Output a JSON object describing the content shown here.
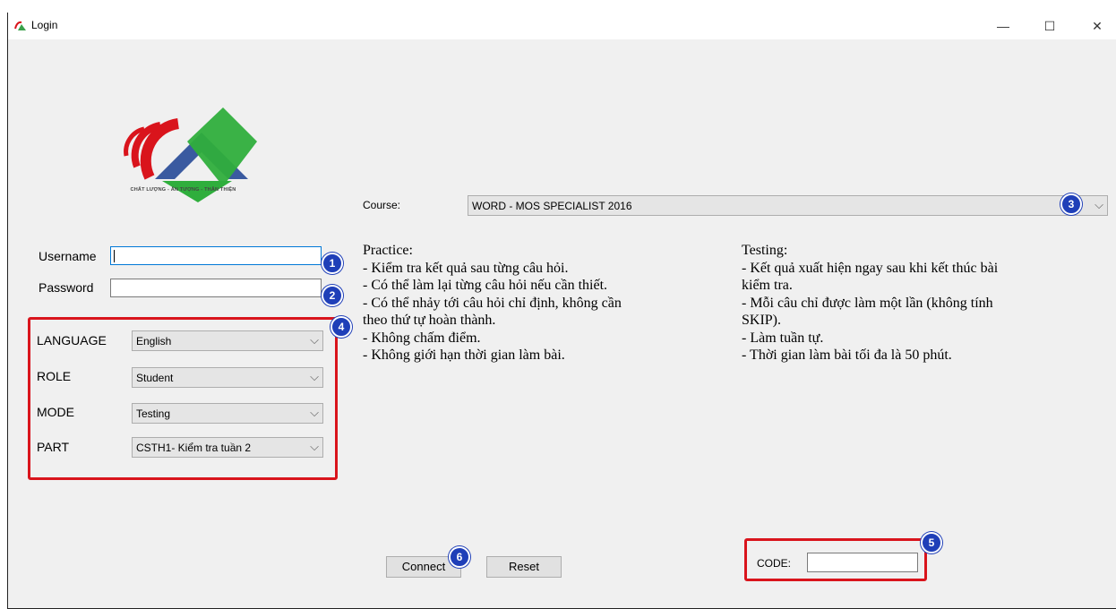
{
  "window": {
    "title": "Login",
    "minimize": "—",
    "maximize": "☐",
    "close": "✕"
  },
  "logo": {
    "caption": "CHẤT LƯỢNG - ẤN TƯỢNG - THÂN THIỆN"
  },
  "course": {
    "label": "Course:",
    "value": "WORD - MOS SPECIALIST 2016"
  },
  "login": {
    "username_label": "Username",
    "username_value": "",
    "password_label": "Password",
    "password_value": ""
  },
  "settings": [
    {
      "label": "LANGUAGE",
      "value": "English"
    },
    {
      "label": "ROLE",
      "value": "Student"
    },
    {
      "label": "MODE",
      "value": "Testing"
    },
    {
      "label": "PART",
      "value": "CSTH1- Kiểm tra tuần 2"
    }
  ],
  "practice": {
    "heading": "Practice:",
    "lines": [
      "- Kiểm tra kết quả sau từng câu hỏi.",
      "- Có thể làm lại từng câu hỏi nếu cần thiết.",
      "- Có thể nhảy tới câu hỏi chỉ định, không cần",
      "theo thứ tự hoàn thành.",
      "- Không chấm điểm.",
      "- Không giới hạn thời gian làm bài."
    ]
  },
  "testing": {
    "heading": "Testing:",
    "lines": [
      "- Kết quả xuất hiện ngay sau khi kết thúc bài",
      "kiểm tra.",
      "- Mỗi câu chỉ được làm một lần (không tính",
      "SKIP).",
      "- Làm tuần tự.",
      "- Thời gian làm bài tối đa là 50 phút."
    ]
  },
  "buttons": {
    "connect": "Connect",
    "reset": "Reset"
  },
  "code": {
    "label": "CODE:",
    "value": ""
  },
  "badges": [
    "1",
    "2",
    "3",
    "4",
    "5",
    "6"
  ],
  "colors": {
    "badge": "#1f3fb8",
    "highlight": "#d9141c",
    "focus": "#0078d7"
  }
}
